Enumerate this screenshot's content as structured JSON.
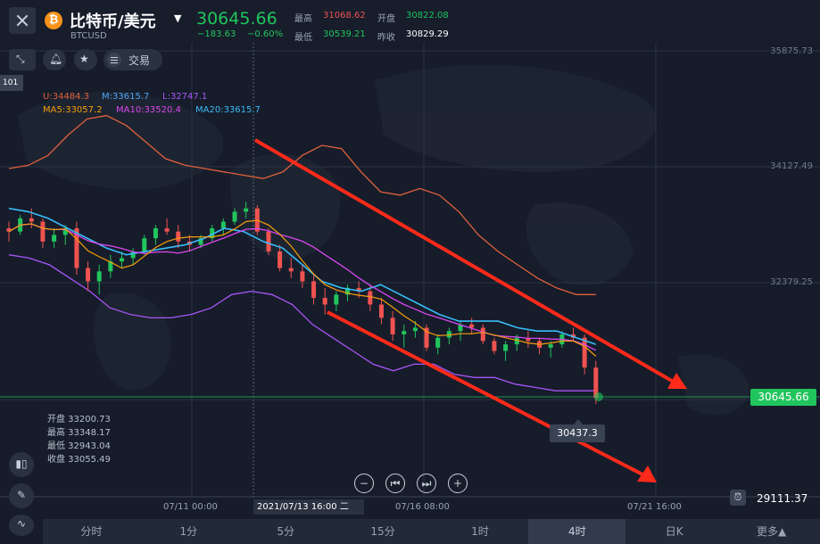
{
  "header": {
    "close_icon": "close-icon",
    "coin_icon": "bitcoin-icon",
    "coin_glyph": "₿",
    "symbol_title": "比特币/美元",
    "symbol_code": "BTCUSD",
    "last_price": "30645.66",
    "change": "−183.63",
    "change_pct": "−0.60%",
    "stats": {
      "high_label": "最高",
      "high_value": "31068.62",
      "open_label": "开盘",
      "open_value": "30822.08",
      "low_label": "最低",
      "low_value": "30539.21",
      "prev_close_label": "昨收",
      "prev_close_value": "30829.29"
    },
    "colors": {
      "up": "#21c55d",
      "down": "#ef5350",
      "neutral": "#c9d1dc"
    }
  },
  "toolbar": {
    "shrink_icon": "shrink-icon",
    "bell_icon": "bell-icon",
    "star_icon": "star-icon",
    "trade_icon": "list-icon",
    "trade_label": "交易",
    "interval_tag": "101"
  },
  "indicators": {
    "boll_u": "U:34484.3",
    "boll_m": "M:33615.7",
    "boll_l": "L:32747.1",
    "ma5": "MA5:33057.2",
    "ma10": "MA10:33520.4",
    "ma20": "MA20:33615.7",
    "colors": {
      "boll_u": "#e0603c",
      "boll_m": "#4fa3f7",
      "boll_l": "#a855f7",
      "ma5": "#f59e0b",
      "ma10": "#d946ef",
      "ma20": "#38bdf8"
    }
  },
  "price_axis": {
    "labels": [
      "35875.73",
      "34127.49",
      "32379.25"
    ],
    "current_price_tag": "30645.66",
    "low_marker": "30437.3",
    "axis_low": "29111.37",
    "alarm_icon": "alarm-icon"
  },
  "time_axis": {
    "labels": [
      "07/11 00:00",
      "07/16 08:00",
      "07/21 16:00"
    ],
    "crosshair_label": "2021/07/13 16:00 二"
  },
  "ohlc": {
    "open": "开盘 33200.73",
    "high": "最高 33348.17",
    "low": "最低 32943.04",
    "close": "收盘 33055.49"
  },
  "side_tools": [
    {
      "name": "candles-icon"
    },
    {
      "name": "pen-icon"
    },
    {
      "name": "indicator-icon"
    }
  ],
  "zoom": {
    "zoom_out": "−",
    "scroll_start": "⏮",
    "scroll_end": "⏭",
    "zoom_in": "+"
  },
  "tabs": [
    {
      "label": "分时",
      "active": false
    },
    {
      "label": "1分",
      "active": false
    },
    {
      "label": "5分",
      "active": false
    },
    {
      "label": "15分",
      "active": false
    },
    {
      "label": "1时",
      "active": false
    },
    {
      "label": "4时",
      "active": true
    },
    {
      "label": "日K",
      "active": false
    },
    {
      "label": "更多▲",
      "active": false
    }
  ],
  "chart_data": {
    "type": "candlestick",
    "candles": [
      [
        33200,
        33300,
        33000,
        33150
      ],
      [
        33150,
        33400,
        33100,
        33350
      ],
      [
        33350,
        33500,
        33200,
        33300
      ],
      [
        33300,
        33350,
        32900,
        33000
      ],
      [
        33000,
        33200,
        32900,
        33100
      ],
      [
        33100,
        33250,
        32950,
        33200
      ],
      [
        33200,
        33300,
        32500,
        32600
      ],
      [
        32600,
        32700,
        32250,
        32400
      ],
      [
        32400,
        32650,
        32200,
        32550
      ],
      [
        32550,
        32800,
        32450,
        32700
      ],
      [
        32700,
        32850,
        32600,
        32750
      ],
      [
        32750,
        32900,
        32650,
        32850
      ],
      [
        32850,
        33100,
        32800,
        33050
      ],
      [
        33050,
        33250,
        32950,
        33200
      ],
      [
        33200,
        33350,
        33100,
        33150
      ],
      [
        33150,
        33250,
        32900,
        33000
      ],
      [
        33000,
        33100,
        32850,
        32950
      ],
      [
        32950,
        33100,
        32900,
        33050
      ],
      [
        33050,
        33250,
        33000,
        33200
      ],
      [
        33200,
        33350,
        33100,
        33300
      ],
      [
        33300,
        33500,
        33250,
        33450
      ],
      [
        33450,
        33600,
        33350,
        33500
      ],
      [
        33500,
        33550,
        33100,
        33150
      ],
      [
        33150,
        33200,
        32800,
        32850
      ],
      [
        32850,
        32950,
        32550,
        32600
      ],
      [
        32600,
        32750,
        32450,
        32550
      ],
      [
        32550,
        32650,
        32300,
        32400
      ],
      [
        32400,
        32500,
        32050,
        32150
      ],
      [
        32150,
        32300,
        31900,
        32050
      ],
      [
        32050,
        32250,
        31950,
        32200
      ],
      [
        32200,
        32350,
        32100,
        32300
      ],
      [
        32300,
        32400,
        32150,
        32250
      ],
      [
        32250,
        32350,
        31950,
        32050
      ],
      [
        32050,
        32150,
        31750,
        31850
      ],
      [
        31850,
        31950,
        31500,
        31600
      ],
      [
        31600,
        31750,
        31400,
        31650
      ],
      [
        31650,
        31800,
        31550,
        31700
      ],
      [
        31700,
        31750,
        31350,
        31400
      ],
      [
        31400,
        31600,
        31300,
        31550
      ],
      [
        31550,
        31700,
        31450,
        31650
      ],
      [
        31650,
        31800,
        31500,
        31750
      ],
      [
        31750,
        31850,
        31600,
        31700
      ],
      [
        31700,
        31750,
        31450,
        31500
      ],
      [
        31500,
        31550,
        31300,
        31350
      ],
      [
        31350,
        31500,
        31200,
        31450
      ],
      [
        31450,
        31600,
        31350,
        31550
      ],
      [
        31550,
        31650,
        31400,
        31500
      ],
      [
        31500,
        31550,
        31300,
        31400
      ],
      [
        31400,
        31500,
        31250,
        31450
      ],
      [
        31450,
        31650,
        31400,
        31600
      ],
      [
        31600,
        31700,
        31500,
        31550
      ],
      [
        31550,
        31600,
        31000,
        31100
      ],
      [
        31100,
        31200,
        30550,
        30646
      ]
    ],
    "boll_upper": [
      34100,
      34150,
      34300,
      34600,
      34850,
      34900,
      34750,
      34500,
      34250,
      34150,
      34100,
      34050,
      34000,
      33950,
      34050,
      34300,
      34450,
      34400,
      34050,
      33750,
      33700,
      33800,
      33700,
      33450,
      33100,
      32850,
      32650,
      32450,
      32300,
      32200,
      32200
    ],
    "boll_mid": [
      33500,
      33450,
      33350,
      33200,
      33050,
      32900,
      32800,
      32850,
      32900,
      32950,
      33050,
      33200,
      33150,
      33000,
      32900,
      32650,
      32400,
      32300,
      32250,
      32350,
      32200,
      32050,
      31900,
      31800,
      31800,
      31800,
      31700,
      31650,
      31650,
      31550,
      31450
    ],
    "boll_lower": [
      32800,
      32750,
      32650,
      32450,
      32250,
      32000,
      31900,
      31850,
      31850,
      31900,
      32000,
      32200,
      32250,
      32200,
      32050,
      31750,
      31550,
      31350,
      31150,
      31050,
      31150,
      31150,
      31000,
      30950,
      30950,
      30850,
      30800,
      30750,
      30750,
      30750
    ],
    "y_axis_labels": [
      35875.73,
      34127.49,
      32379.25
    ],
    "current_price": 30645.66,
    "period_low": 30437.3,
    "trend_lines": "two red descending channel arrows",
    "title": "",
    "xlabel": "",
    "ylabel": ""
  }
}
